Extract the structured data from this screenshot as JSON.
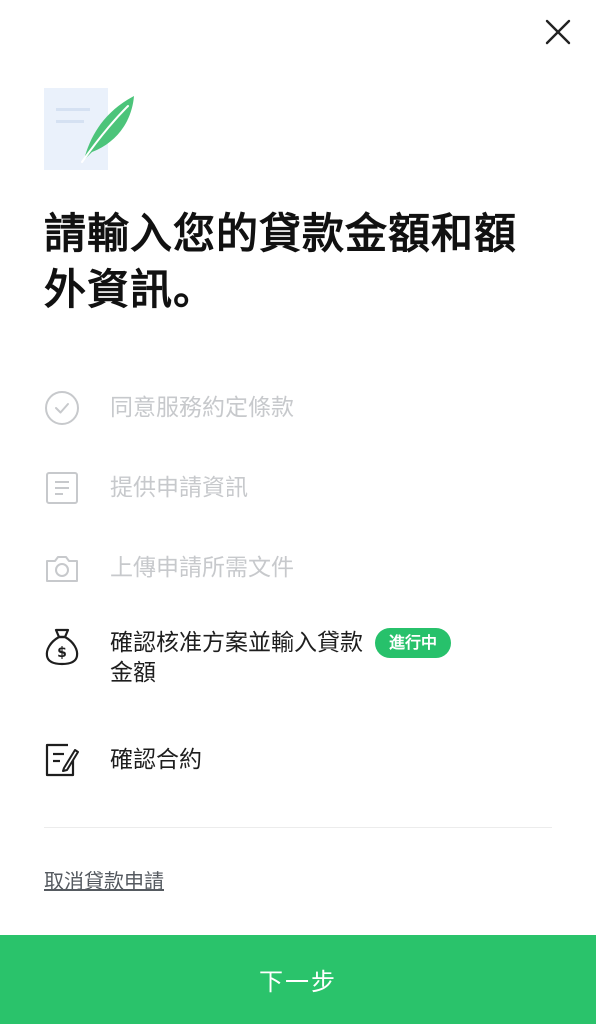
{
  "header": {
    "close_icon": "close-icon",
    "illustration_icon": "feather-document-icon"
  },
  "title": "請輸入您的貸款金額和額外資訊。",
  "steps": [
    {
      "label": "同意服務約定條款",
      "icon": "check-circle-icon",
      "state": "done"
    },
    {
      "label": "提供申請資訊",
      "icon": "document-icon",
      "state": "done"
    },
    {
      "label": "上傳申請所需文件",
      "icon": "camera-icon",
      "state": "done"
    },
    {
      "label_line1": "確認核准方案並輸入貸款",
      "label_line2": "金額",
      "icon": "money-bag-icon",
      "state": "current",
      "badge": "進行中"
    },
    {
      "label": "確認合約",
      "icon": "sign-contract-icon",
      "state": "pending"
    }
  ],
  "cancel_link": "取消貸款申請",
  "next_button": "下一步",
  "colors": {
    "accent": "#27c16b",
    "done_text": "#c7c9cc",
    "pending_text": "#1e1e1e"
  }
}
